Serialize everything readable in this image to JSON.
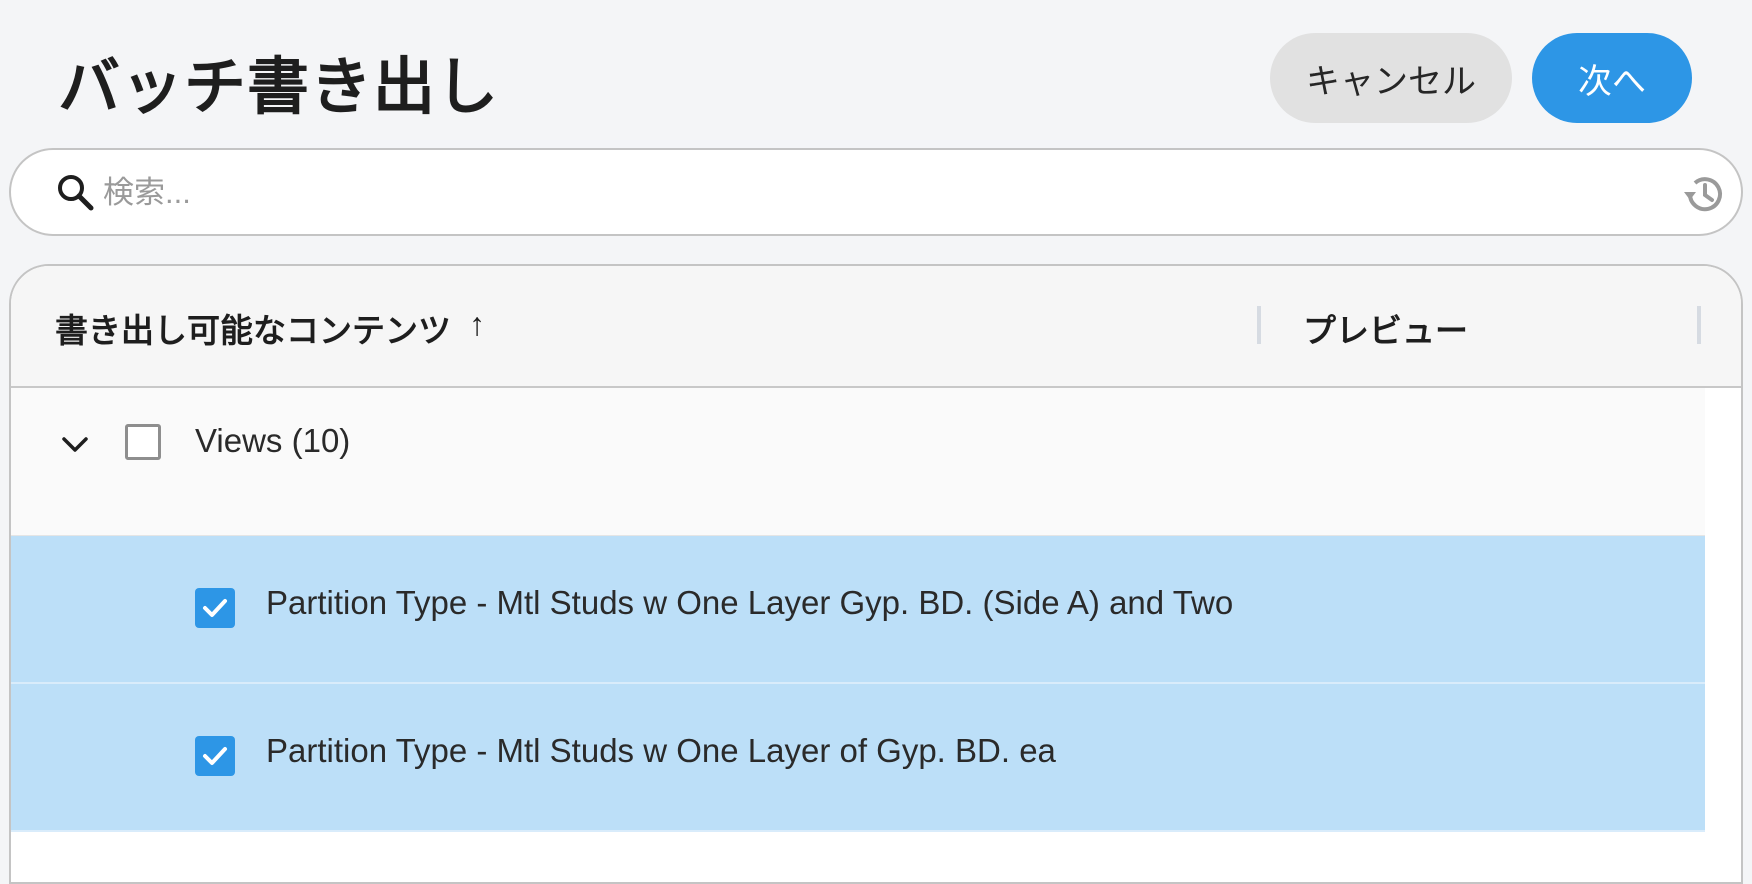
{
  "header": {
    "title": "バッチ書き出し",
    "cancel_label": "キャンセル",
    "next_label": "次へ"
  },
  "search": {
    "placeholder": "検索...",
    "value": ""
  },
  "table": {
    "columns": {
      "content": "書き出し可能なコンテンツ",
      "content_sort_icon": "↑",
      "preview": "プレビュー"
    },
    "group": {
      "label": "Views (10)",
      "expanded": true,
      "checked": false
    },
    "items": [
      {
        "label": "Partition Type - Mtl Studs w One Layer Gyp. BD. (Side A) and Two",
        "checked": true
      },
      {
        "label": "Partition Type - Mtl Studs w One Layer of Gyp. BD. ea",
        "checked": true
      }
    ]
  },
  "colors": {
    "accent": "#2d96e6",
    "selected_row": "#bcdff8",
    "cancel_bg": "#e1e1e1"
  },
  "icons": [
    "search-icon",
    "history-icon",
    "sort-ascending-icon",
    "chevron-down-icon",
    "checkbox-icon",
    "checkmark-icon"
  ]
}
